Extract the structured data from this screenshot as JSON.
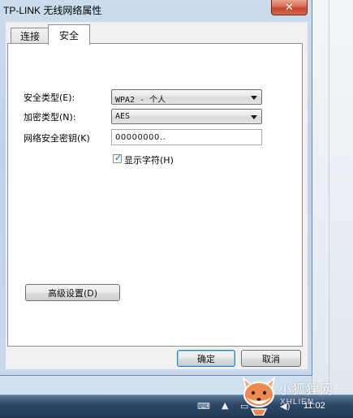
{
  "window": {
    "title": "TP-LINK 无线网络属性",
    "close_glyph": "✕"
  },
  "tabs": [
    {
      "label": "连接",
      "active": false
    },
    {
      "label": "安全",
      "active": true
    }
  ],
  "form": {
    "security_type_label": "安全类型(E):",
    "security_type_value": "WPA2 - 个人",
    "encryption_type_label": "加密类型(N):",
    "encryption_type_value": "AES",
    "network_key_label": "网络安全密钥(K)",
    "network_key_value": "00000000..",
    "show_chars_label": "显示字符(H)",
    "show_chars_checked": true,
    "advanced_button": "高级设置(D)"
  },
  "buttons": {
    "ok": "确定",
    "cancel": "取消"
  },
  "taskbar": {
    "clock": "11:02",
    "icons": [
      "keyboard-icon",
      "show-hidden-icons-arrow",
      "network-icon",
      "volume-icon"
    ]
  },
  "watermark": {
    "text": "小狐狸网",
    "sub": "XHLIEN"
  }
}
